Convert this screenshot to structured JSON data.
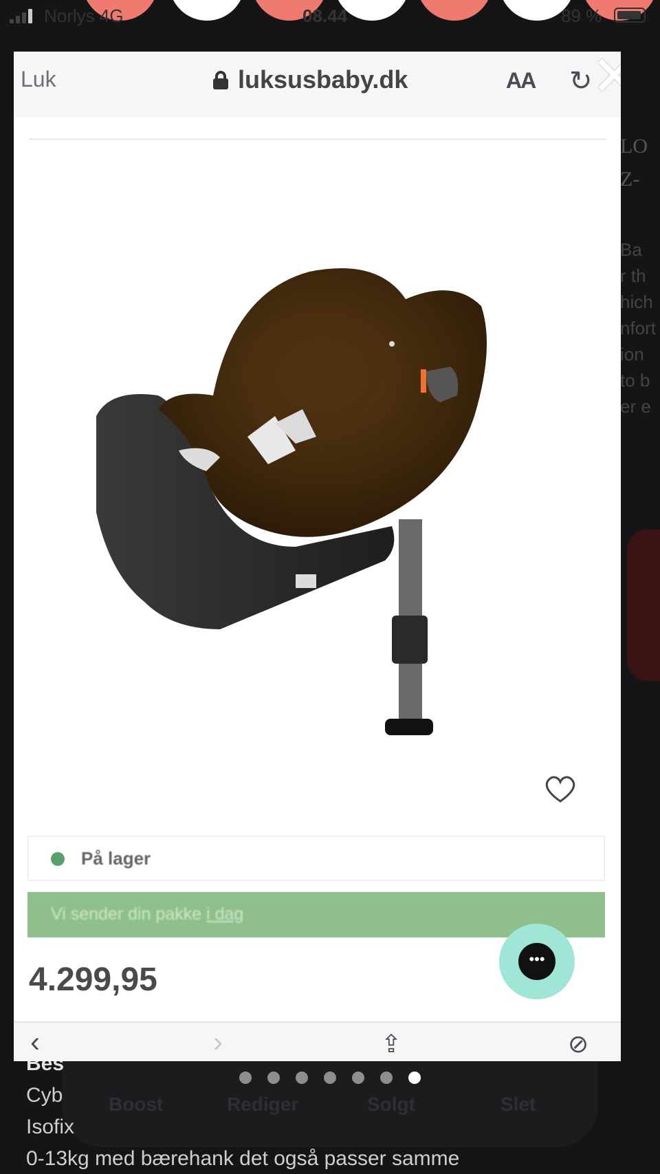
{
  "status_bar": {
    "carrier": "Norlys  4G",
    "time": "08.44",
    "battery_pct": "89 %"
  },
  "background_page": {
    "right_letters": [
      "LO",
      "Z-"
    ],
    "right_text": [
      "Ba",
      "r th",
      "hich",
      "nfort",
      "ion",
      "to b",
      "er e"
    ],
    "heading_partial": "Bes",
    "lines": [
      "Cyb",
      "Isofix",
      "0-13kg med bærehank det også passer samme"
    ],
    "actions": [
      "Boost",
      "Rediger",
      "Solgt",
      "Slet"
    ]
  },
  "modal": {
    "close_label": "Luk",
    "domain": "luksusbaby.dk",
    "text_size_label": "AA",
    "stock_label": "På lager",
    "ship_text": "Vi sender din pakke",
    "ship_link": "i dag",
    "price": "4.299,95"
  },
  "colors": {
    "accent_green": "#8fbf8c",
    "stock_dot": "#5aa06a",
    "chat_bubble": "#9fe6d6"
  },
  "pager": {
    "count": 7,
    "active_index": 6
  }
}
